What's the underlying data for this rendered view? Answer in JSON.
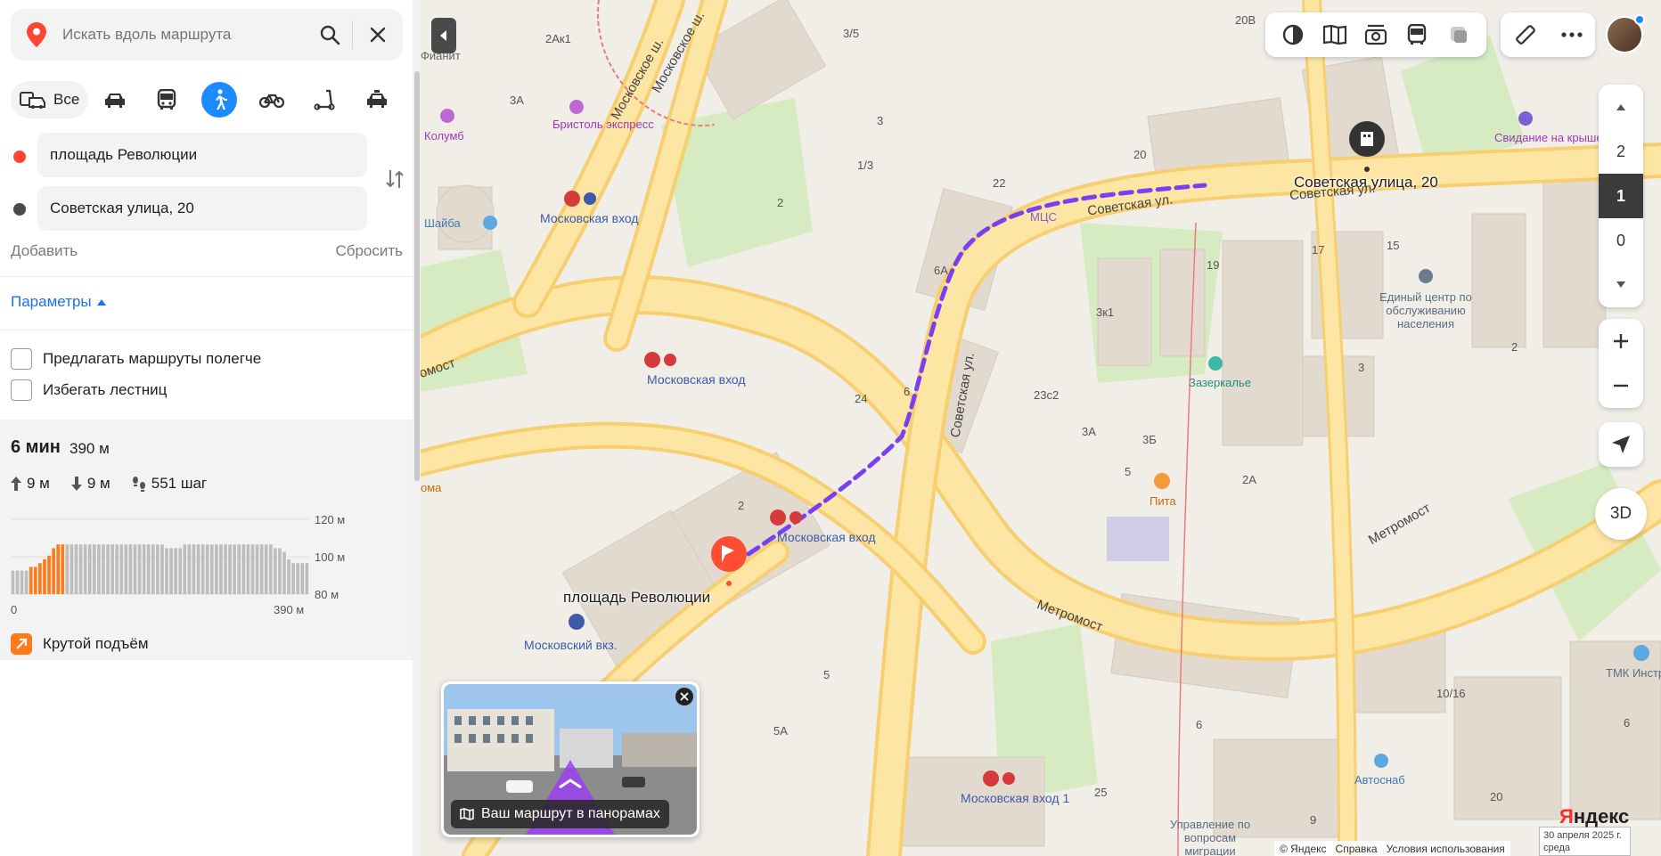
{
  "search": {
    "placeholder": "Искать вдоль маршрута"
  },
  "modes": {
    "all_label": "Все",
    "items": [
      "car-icon",
      "bus-icon",
      "walk-icon",
      "bike-icon",
      "scooter-icon",
      "taxi-icon"
    ],
    "active": "walk-icon"
  },
  "route": {
    "from": "площадь Революции",
    "to": "Советская улица, 20",
    "add_label": "Добавить",
    "reset_label": "Сбросить"
  },
  "params": {
    "label": "Параметры"
  },
  "options": [
    {
      "label": "Предлагать маршруты полегче",
      "checked": false
    },
    {
      "label": "Избегать лестниц",
      "checked": false
    }
  ],
  "summary": {
    "time": "6 мин",
    "distance": "390 м",
    "ascent": "9 м",
    "descent": "9 м",
    "steps": "551 шаг"
  },
  "elevation": {
    "y_labels": [
      "120 м",
      "100 м",
      "80 м"
    ],
    "x_start": "0",
    "x_end": "390 м",
    "profile": [
      2,
      2,
      2,
      2,
      3,
      3,
      4,
      5,
      6,
      8,
      9,
      9,
      9,
      9,
      9,
      9,
      9,
      9,
      9,
      9,
      9,
      9,
      9,
      9,
      9,
      9,
      9,
      9,
      9,
      9,
      9,
      9,
      9,
      9,
      8,
      8,
      8,
      8,
      9,
      9,
      9,
      9,
      9,
      9,
      9,
      9,
      9,
      9,
      9,
      9,
      9,
      9,
      9,
      9,
      9,
      9,
      9,
      9,
      8,
      8,
      7,
      5,
      4,
      4,
      4,
      4
    ],
    "steep_range": [
      4,
      11
    ]
  },
  "steep": {
    "label": "Крутой подъём"
  },
  "map": {
    "dest_label": "Советская улица, 20",
    "start_label": "площадь Революции",
    "metro_labels": [
      "Московская вход",
      "Московская вход",
      "Московская вход",
      "Московская вход 1"
    ],
    "road_labels": [
      "Московское ш.",
      "Московское ш.",
      "Советская ул.",
      "Советская ул.",
      "Советская ул.",
      "Метромост",
      "Метромост",
      "омост"
    ],
    "poi_labels": [
      "Бристоль экспресс",
      "Колумб",
      "Свидание на крыше",
      "Шайба",
      "Пита",
      "Зазеркалье",
      "Автоснаб",
      "МЦС"
    ],
    "org_labels": [
      "Единый центр по обслуживанию населения",
      "Управление по вопросам миграции",
      "ТМК Инстру",
      "Московский вкз.",
      "Фианит"
    ],
    "house_numbers": [
      "2Ак1",
      "3/5",
      "3А",
      "3",
      "1/3",
      "2",
      "20",
      "22",
      "6А",
      "3к1",
      "24",
      "6",
      "23с2",
      "3А",
      "3Б",
      "5",
      "2А",
      "2",
      "19",
      "17",
      "15",
      "3",
      "2",
      "20В",
      "5",
      "5А",
      "25",
      "6",
      "9",
      "20",
      "10/16",
      "6",
      "ома"
    ],
    "floors": [
      "2",
      "1",
      "0"
    ],
    "selected_floor": "1",
    "btn_3d": "3D",
    "pano_caption": "Ваш маршрут в панорамах",
    "footer": [
      "© Яндекс",
      "Справка",
      "Условия использования"
    ],
    "date": "30 апреля 2025 г. среда",
    "logo": "Яндекс"
  },
  "colors": {
    "accent": "#1a8cff",
    "route": "#7a3ff0",
    "start_pin": "#ff4d33",
    "road": "#fbd87a",
    "park": "#cfe8b5",
    "building": "#e3dcd1"
  }
}
